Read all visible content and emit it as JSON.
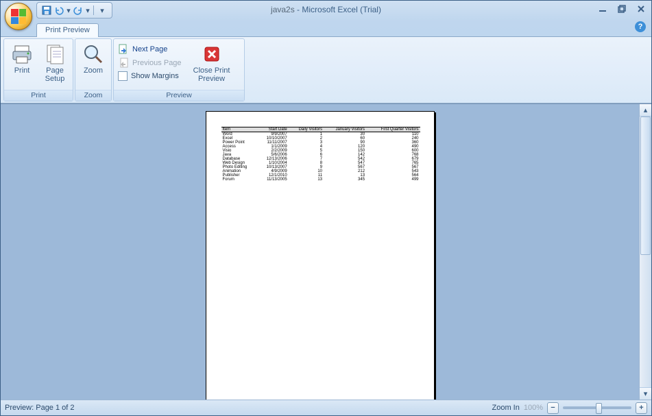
{
  "title": {
    "doc": "java2s",
    "app": " - Microsoft Excel (Trial)"
  },
  "tab": {
    "label": "Print Preview"
  },
  "ribbon": {
    "print_group": "Print",
    "zoom_group": "Zoom",
    "preview_group": "Preview",
    "print": "Print",
    "page_setup": "Page\nSetup",
    "zoom": "Zoom",
    "next_page": "Next Page",
    "previous_page": "Previous Page",
    "show_margins": "Show Margins",
    "close": "Close Print\nPreview"
  },
  "status": {
    "preview": "Preview: Page 1 of 2",
    "zoom_in": "Zoom In",
    "zoom_pct": "100%"
  },
  "sheet": {
    "headers": [
      "Item",
      "Start Date",
      "Daily Visitors",
      "January Visitors",
      "First Quarter Visitors"
    ],
    "rows": [
      [
        "Word",
        "9/9/2007",
        "1",
        "30",
        "110"
      ],
      [
        "Excel",
        "10/10/2007",
        "2",
        "60",
        "240"
      ],
      [
        "Power Point",
        "11/11/2007",
        "3",
        "90",
        "360"
      ],
      [
        "Access",
        "1/1/2009",
        "4",
        "120",
        "490"
      ],
      [
        "Visio",
        "2/2/2009",
        "5",
        "150",
        "600"
      ],
      [
        "Java",
        "5/6/2006",
        "6",
        "142",
        "768"
      ],
      [
        "Database",
        "12/13/2006",
        "7",
        "542",
        "679"
      ],
      [
        "Web Design",
        "1/10/2004",
        "8",
        "547",
        "765"
      ],
      [
        "Photo Editing",
        "10/13/2007",
        "9",
        "567",
        "567"
      ],
      [
        "Animation",
        "4/9/2009",
        "10",
        "212",
        "543"
      ],
      [
        "Publisher",
        "12/1/2010",
        "11",
        "13",
        "564"
      ],
      [
        "Forum",
        "11/13/2005",
        "13",
        "345",
        "499"
      ]
    ]
  }
}
